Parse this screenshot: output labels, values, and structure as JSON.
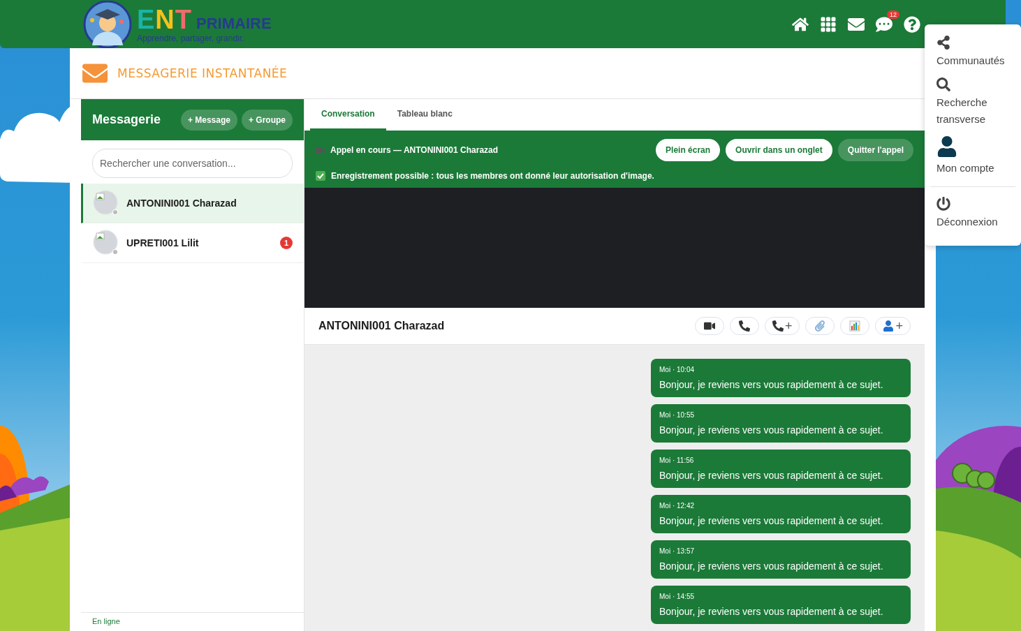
{
  "header": {
    "logo": {
      "title": "ENT",
      "subtitle": "PRIMAIRE",
      "tagline": "Apprendre, partager, grandir."
    },
    "nav": [
      {
        "kind": "home"
      },
      {
        "kind": "apps"
      },
      {
        "kind": "mail"
      },
      {
        "kind": "chat",
        "badge": "12"
      },
      {
        "kind": "help"
      }
    ]
  },
  "page_title": "MESSAGERIE INSTANTANÉE",
  "sidebar": {
    "title": "Messagerie",
    "buttons": [
      "+ Message",
      "+ Groupe"
    ],
    "search": {
      "placeholder": "Rechercher une conversation..."
    },
    "conversations": [
      {
        "name": "ANTONINI001 Charazad",
        "selected": true
      },
      {
        "name": "UPRETI001 Lilit",
        "selected": false,
        "unread": "1"
      }
    ],
    "status": "En ligne"
  },
  "tabs": [
    {
      "label": "Conversation",
      "selected": true
    },
    {
      "label": "Tableau blanc",
      "selected": false
    }
  ],
  "call": {
    "status": "Appel en cours — ANTONINI001 Charazad",
    "buttons": [
      {
        "label": "Plein écran",
        "kind": "light"
      },
      {
        "label": "Ouvrir dans un onglet",
        "kind": "light"
      },
      {
        "label": "Quitter l'appel",
        "kind": "muted"
      }
    ],
    "notice": "Enregistrement possible : tous les membres ont donné leur autorisation d'image."
  },
  "conversation": {
    "name": "ANTONINI001 Charazad",
    "tools": [
      {
        "kind": "video"
      },
      {
        "kind": "phone"
      },
      {
        "kind": "phone",
        "suffix": "+"
      },
      {
        "kind": "clip"
      },
      {
        "kind": "chart"
      },
      {
        "kind": "user",
        "suffix": "+"
      }
    ],
    "messages": [
      {
        "meta": "Moi · 10:04",
        "text": "Bonjour, je reviens vers vous rapidement à ce sujet."
      },
      {
        "meta": "Moi · 10:55",
        "text": "Bonjour, je reviens vers vous rapidement à ce sujet."
      },
      {
        "meta": "Moi · 11:56",
        "text": "Bonjour, je reviens vers vous rapidement à ce sujet."
      },
      {
        "meta": "Moi · 12:42",
        "text": "Bonjour, je reviens vers vous rapidement à ce sujet."
      },
      {
        "meta": "Moi · 13:57",
        "text": "Bonjour, je reviens vers vous rapidement à ce sujet."
      },
      {
        "meta": "Moi · 14:55",
        "text": "Bonjour, je reviens vers vous rapidement à ce sujet."
      }
    ]
  },
  "user_menu": [
    {
      "kind": "share",
      "label": "Communautés"
    },
    {
      "kind": "search",
      "label": "Recherche transverse"
    },
    {
      "kind": "user",
      "label": "Mon compte"
    },
    {
      "kind": "logout",
      "label": "Déconnexion",
      "divider": true
    }
  ]
}
